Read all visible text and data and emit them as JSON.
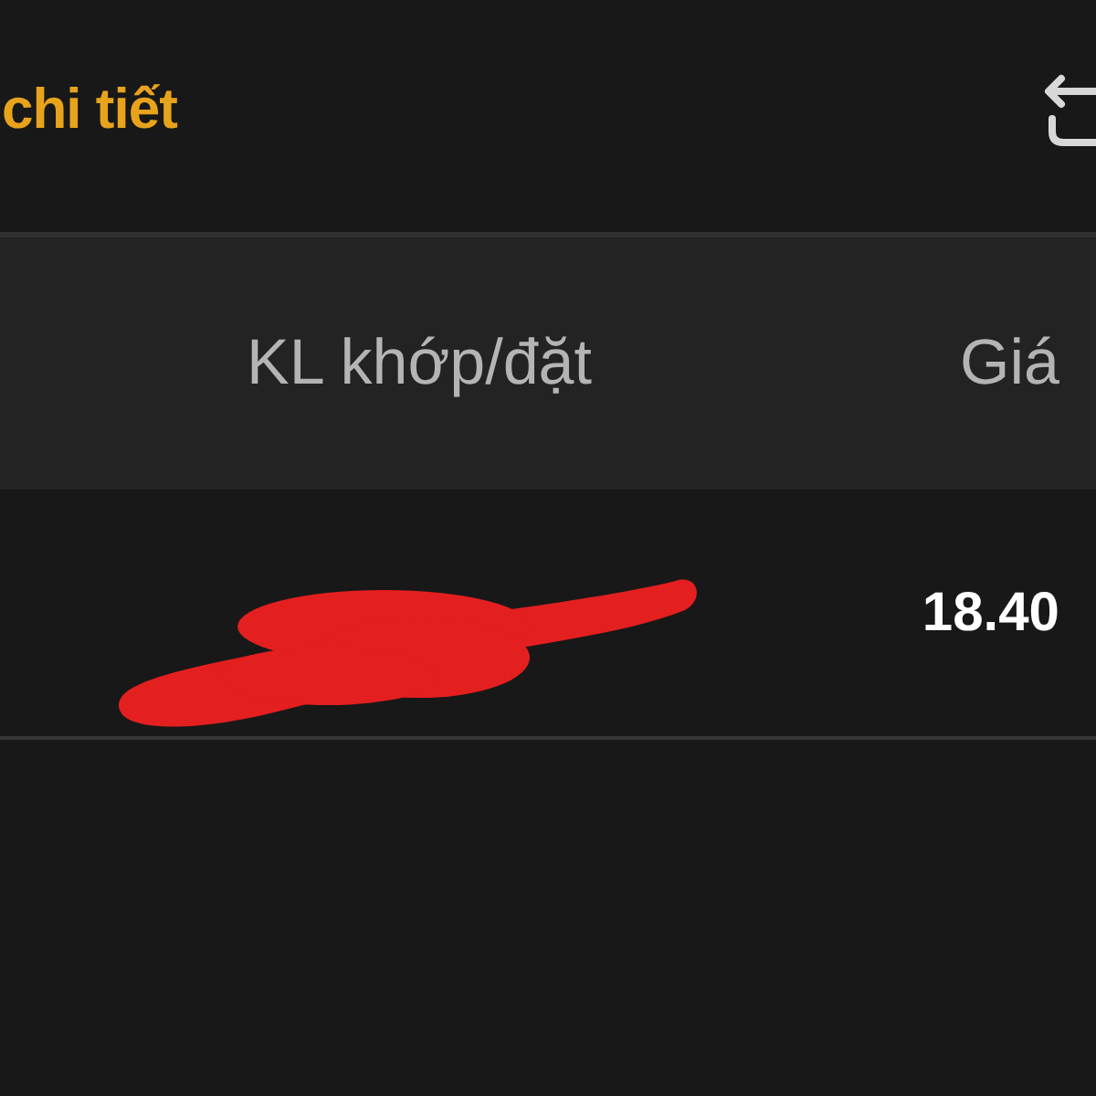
{
  "header": {
    "title": "chi tiết"
  },
  "table": {
    "columns": [
      {
        "label": "KL khớp/đặt"
      },
      {
        "label": "Giá"
      }
    ],
    "rows": [
      {
        "price": "18.40"
      }
    ]
  }
}
